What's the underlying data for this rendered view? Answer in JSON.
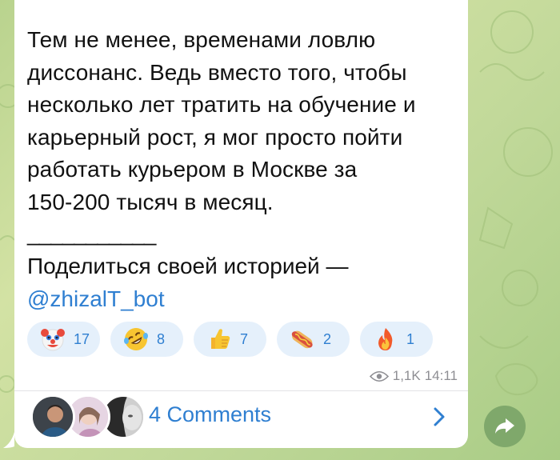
{
  "message": {
    "text": "Тем не менее, временами ловлю\nдиссонанс. Ведь вместо того, чтобы\nнесколько лет тратить на обучение и\nкарьерный рост, я мог просто пойти\nработать курьером в Москве за\n150-200 тысяч в месяц.",
    "separator": "___________",
    "share_text": "Поделиться своей историей —",
    "bot_link": "@zhizalT_bot"
  },
  "reactions": [
    {
      "icon": "clown-face-icon",
      "count": "17"
    },
    {
      "icon": "rolling-laughing-face-icon",
      "count": "8"
    },
    {
      "icon": "thumbs-up-icon",
      "count": "7"
    },
    {
      "icon": "hot-dog-icon",
      "count": "2"
    },
    {
      "icon": "fire-icon",
      "count": "1"
    }
  ],
  "meta": {
    "views": "1,1K",
    "time": "14:11"
  },
  "comments": {
    "label": "4 Comments"
  },
  "colors": {
    "link": "#2f7fd1",
    "reaction_bg": "#e5f0fb",
    "meta_text": "#8e8e93",
    "share_button": "#7fa86b"
  }
}
